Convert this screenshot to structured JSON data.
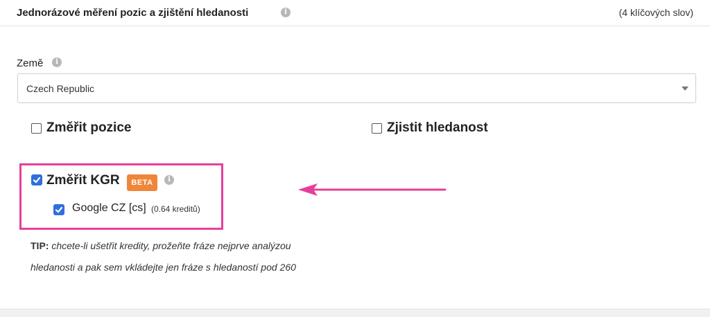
{
  "header": {
    "title": "Jednorázové měření pozic a zjištění hledanosti",
    "info_icon": "i",
    "keyword_count": "(4 klíčových slov)"
  },
  "country": {
    "label": "Země",
    "info_icon": "i",
    "selected": "Czech Republic"
  },
  "options": {
    "measure_positions": {
      "label": "Změřit pozice",
      "checked": false
    },
    "find_search_volume": {
      "label": "Zjistit hledanost",
      "checked": false
    },
    "measure_kgr": {
      "label": "Změřit KGR",
      "checked": true,
      "badge": "BETA",
      "info_icon": "i",
      "engine": {
        "label": "Google CZ [cs]",
        "credits": "(0.64 kreditů)",
        "checked": true
      }
    }
  },
  "tip": {
    "prefix": "TIP:",
    "line1": "chcete-li ušetřit kredity, prožeňte fráze nejprve analýzou",
    "line2": "hledanosti a pak sem vkládejte jen fráze s hledaností pod 260"
  },
  "colors": {
    "highlight": "#e83e9a",
    "beta_badge": "#f0863a",
    "checkbox": "#2f6fde"
  }
}
